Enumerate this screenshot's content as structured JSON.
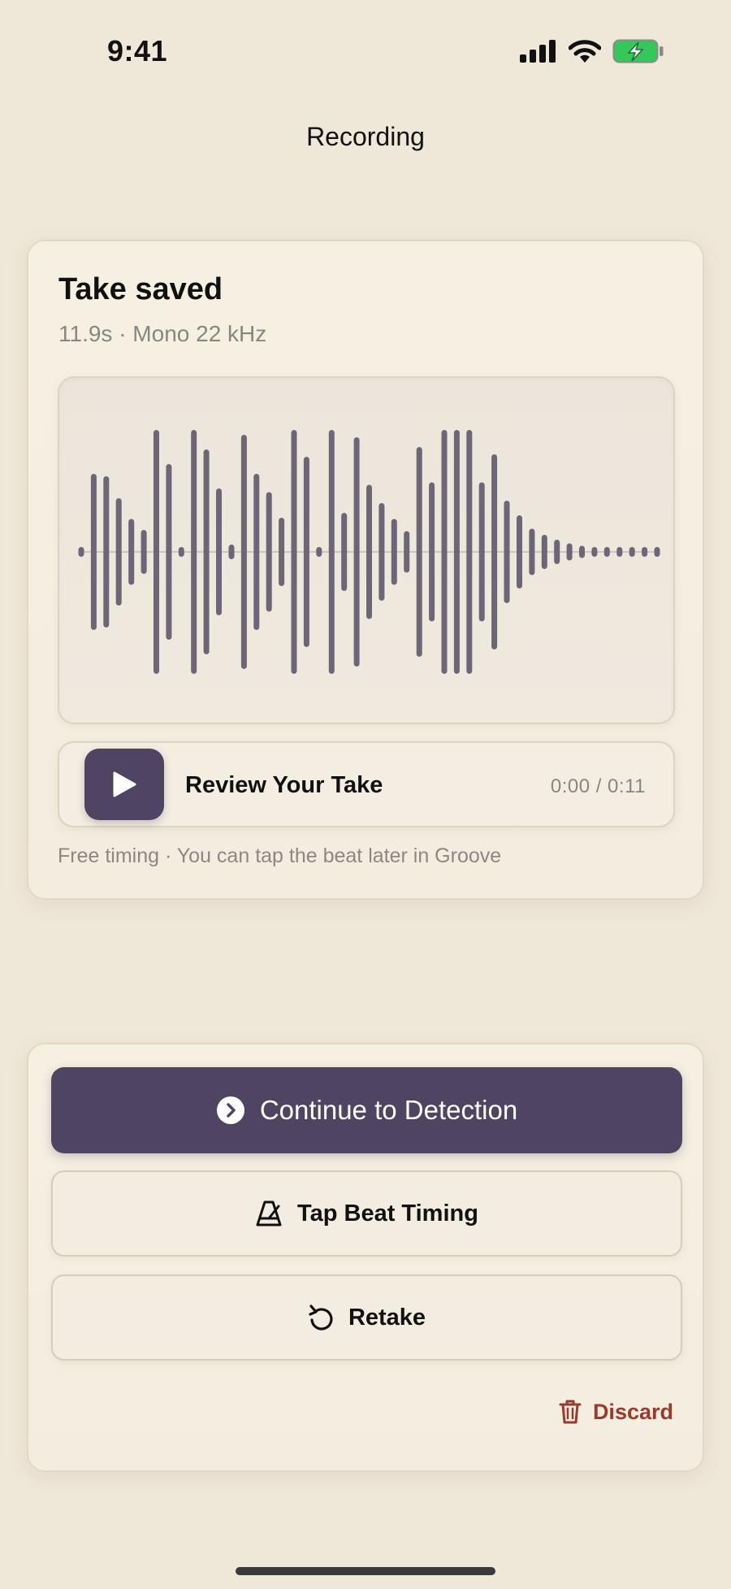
{
  "status_bar": {
    "time": "9:41",
    "signal_icon": "signal-bars-icon",
    "wifi_icon": "wifi-icon",
    "battery_icon": "battery-charging-icon",
    "battery_color": "#34c759"
  },
  "nav": {
    "title": "Recording"
  },
  "take": {
    "title": "Take saved",
    "meta": "11.9s · Mono 22 kHz",
    "waveform": {
      "bar_color": "#6e6577",
      "levels": [
        0.04,
        0.64,
        0.62,
        0.44,
        0.27,
        0.18,
        1.0,
        0.72,
        0.04,
        1.0,
        0.84,
        0.52,
        0.06,
        0.96,
        0.64,
        0.49,
        0.28,
        1.0,
        0.78,
        0.04,
        1.0,
        0.32,
        0.94,
        0.55,
        0.4,
        0.27,
        0.17,
        0.86,
        0.57,
        1.0,
        1.0,
        1.0,
        0.57,
        0.8,
        0.42,
        0.3,
        0.19,
        0.14,
        0.1,
        0.07,
        0.05,
        0.04,
        0.04,
        0.04,
        0.04,
        0.04,
        0.04
      ]
    },
    "player": {
      "play_icon": "play-icon",
      "label": "Review Your Take",
      "time": "0:00 / 0:11"
    },
    "footnote": "Free timing · You can tap the beat later in Groove"
  },
  "actions": {
    "continue_label": "Continue to Detection",
    "continue_icon": "chevron-right-circle-icon",
    "tap_beat_label": "Tap Beat Timing",
    "tap_beat_icon": "metronome-icon",
    "retake_label": "Retake",
    "retake_icon": "retake-arrow-icon",
    "discard_label": "Discard",
    "discard_icon": "trash-icon"
  },
  "colors": {
    "accent": "#4f4563",
    "background": "#efe7d8",
    "destructive": "#9a3a2c"
  }
}
